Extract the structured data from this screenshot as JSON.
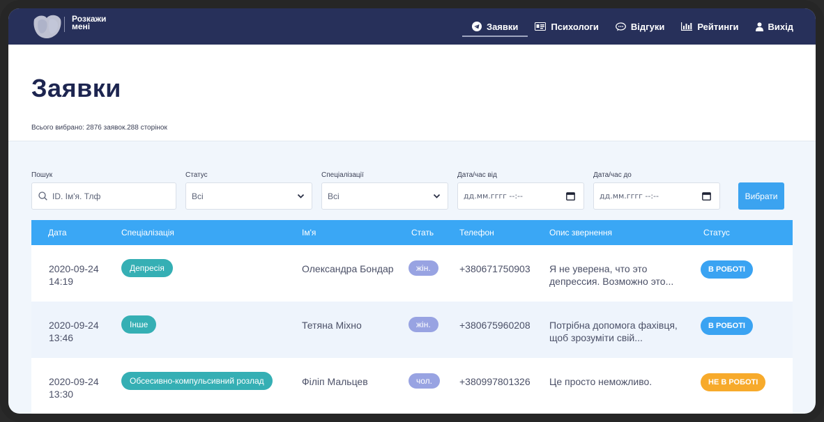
{
  "nav": {
    "logo_line1": "Розкажи",
    "logo_line2": "мені",
    "items": [
      {
        "label": "Заявки",
        "icon": "telegram-icon"
      },
      {
        "label": "Психологи",
        "icon": "id-card-icon"
      },
      {
        "label": "Відгуки",
        "icon": "chat-bubble-icon"
      },
      {
        "label": "Рейтинги",
        "icon": "bar-chart-icon"
      },
      {
        "label": "Вихід",
        "icon": "user-icon"
      }
    ]
  },
  "header": {
    "title": "Заявки",
    "summary": "Всього вибрано: 2876 заявок.288 сторінок"
  },
  "filters": {
    "search_label": "Пошук",
    "search_placeholder": "ID. Ім'я. Тлф",
    "status_label": "Статус",
    "status_value": "Всі",
    "spec_label": "Спеціалізації",
    "spec_value": "Всі",
    "date_from_label": "Дата/час від",
    "date_from_value": "дд.мм.гггг --:--",
    "date_to_label": "Дата/час до",
    "date_to_value": "дд.мм.гггг --:--",
    "submit_label": "Вибрати"
  },
  "table": {
    "headers": [
      "Дата",
      "Спеціалізація",
      "Ім'я",
      "Стать",
      "Телефон",
      "Опис звернення",
      "Статус"
    ],
    "rows": [
      {
        "date": "2020-09-24",
        "time": "14:19",
        "spec": "Депресія",
        "name": "Олександра Бондар",
        "sex": "жін.",
        "phone": "+380671750903",
        "desc1": "Я не уверена, что это",
        "desc2": "депрессия. Возможно это...",
        "status": "В РОБОТІ",
        "status_color": "#3aa3f2"
      },
      {
        "date": "2020-09-24",
        "time": "13:46",
        "spec": "Інше",
        "name": "Тетяна Міхно",
        "sex": "жін.",
        "phone": "+380675960208",
        "desc1": "Потрібна допомога фахівця,",
        "desc2": "щоб зрозуміти свій...",
        "status": "В РОБОТІ",
        "status_color": "#3aa3f2"
      },
      {
        "date": "2020-09-24",
        "time": "13:30",
        "spec": "Обсесивно-компульсивний розлад",
        "name": "Філіп Мальцев",
        "sex": "чол.",
        "phone": "+380997801326",
        "desc1": "Це просто неможливо.",
        "desc2": "",
        "status": "НЕ В РОБОТІ",
        "status_color": "#f7aa2b"
      }
    ]
  },
  "colors": {
    "nav_bg": "#27305a",
    "accent": "#3aa7f5",
    "spec_pill": "#35afb4",
    "sex_pill": "#98a3e2"
  }
}
